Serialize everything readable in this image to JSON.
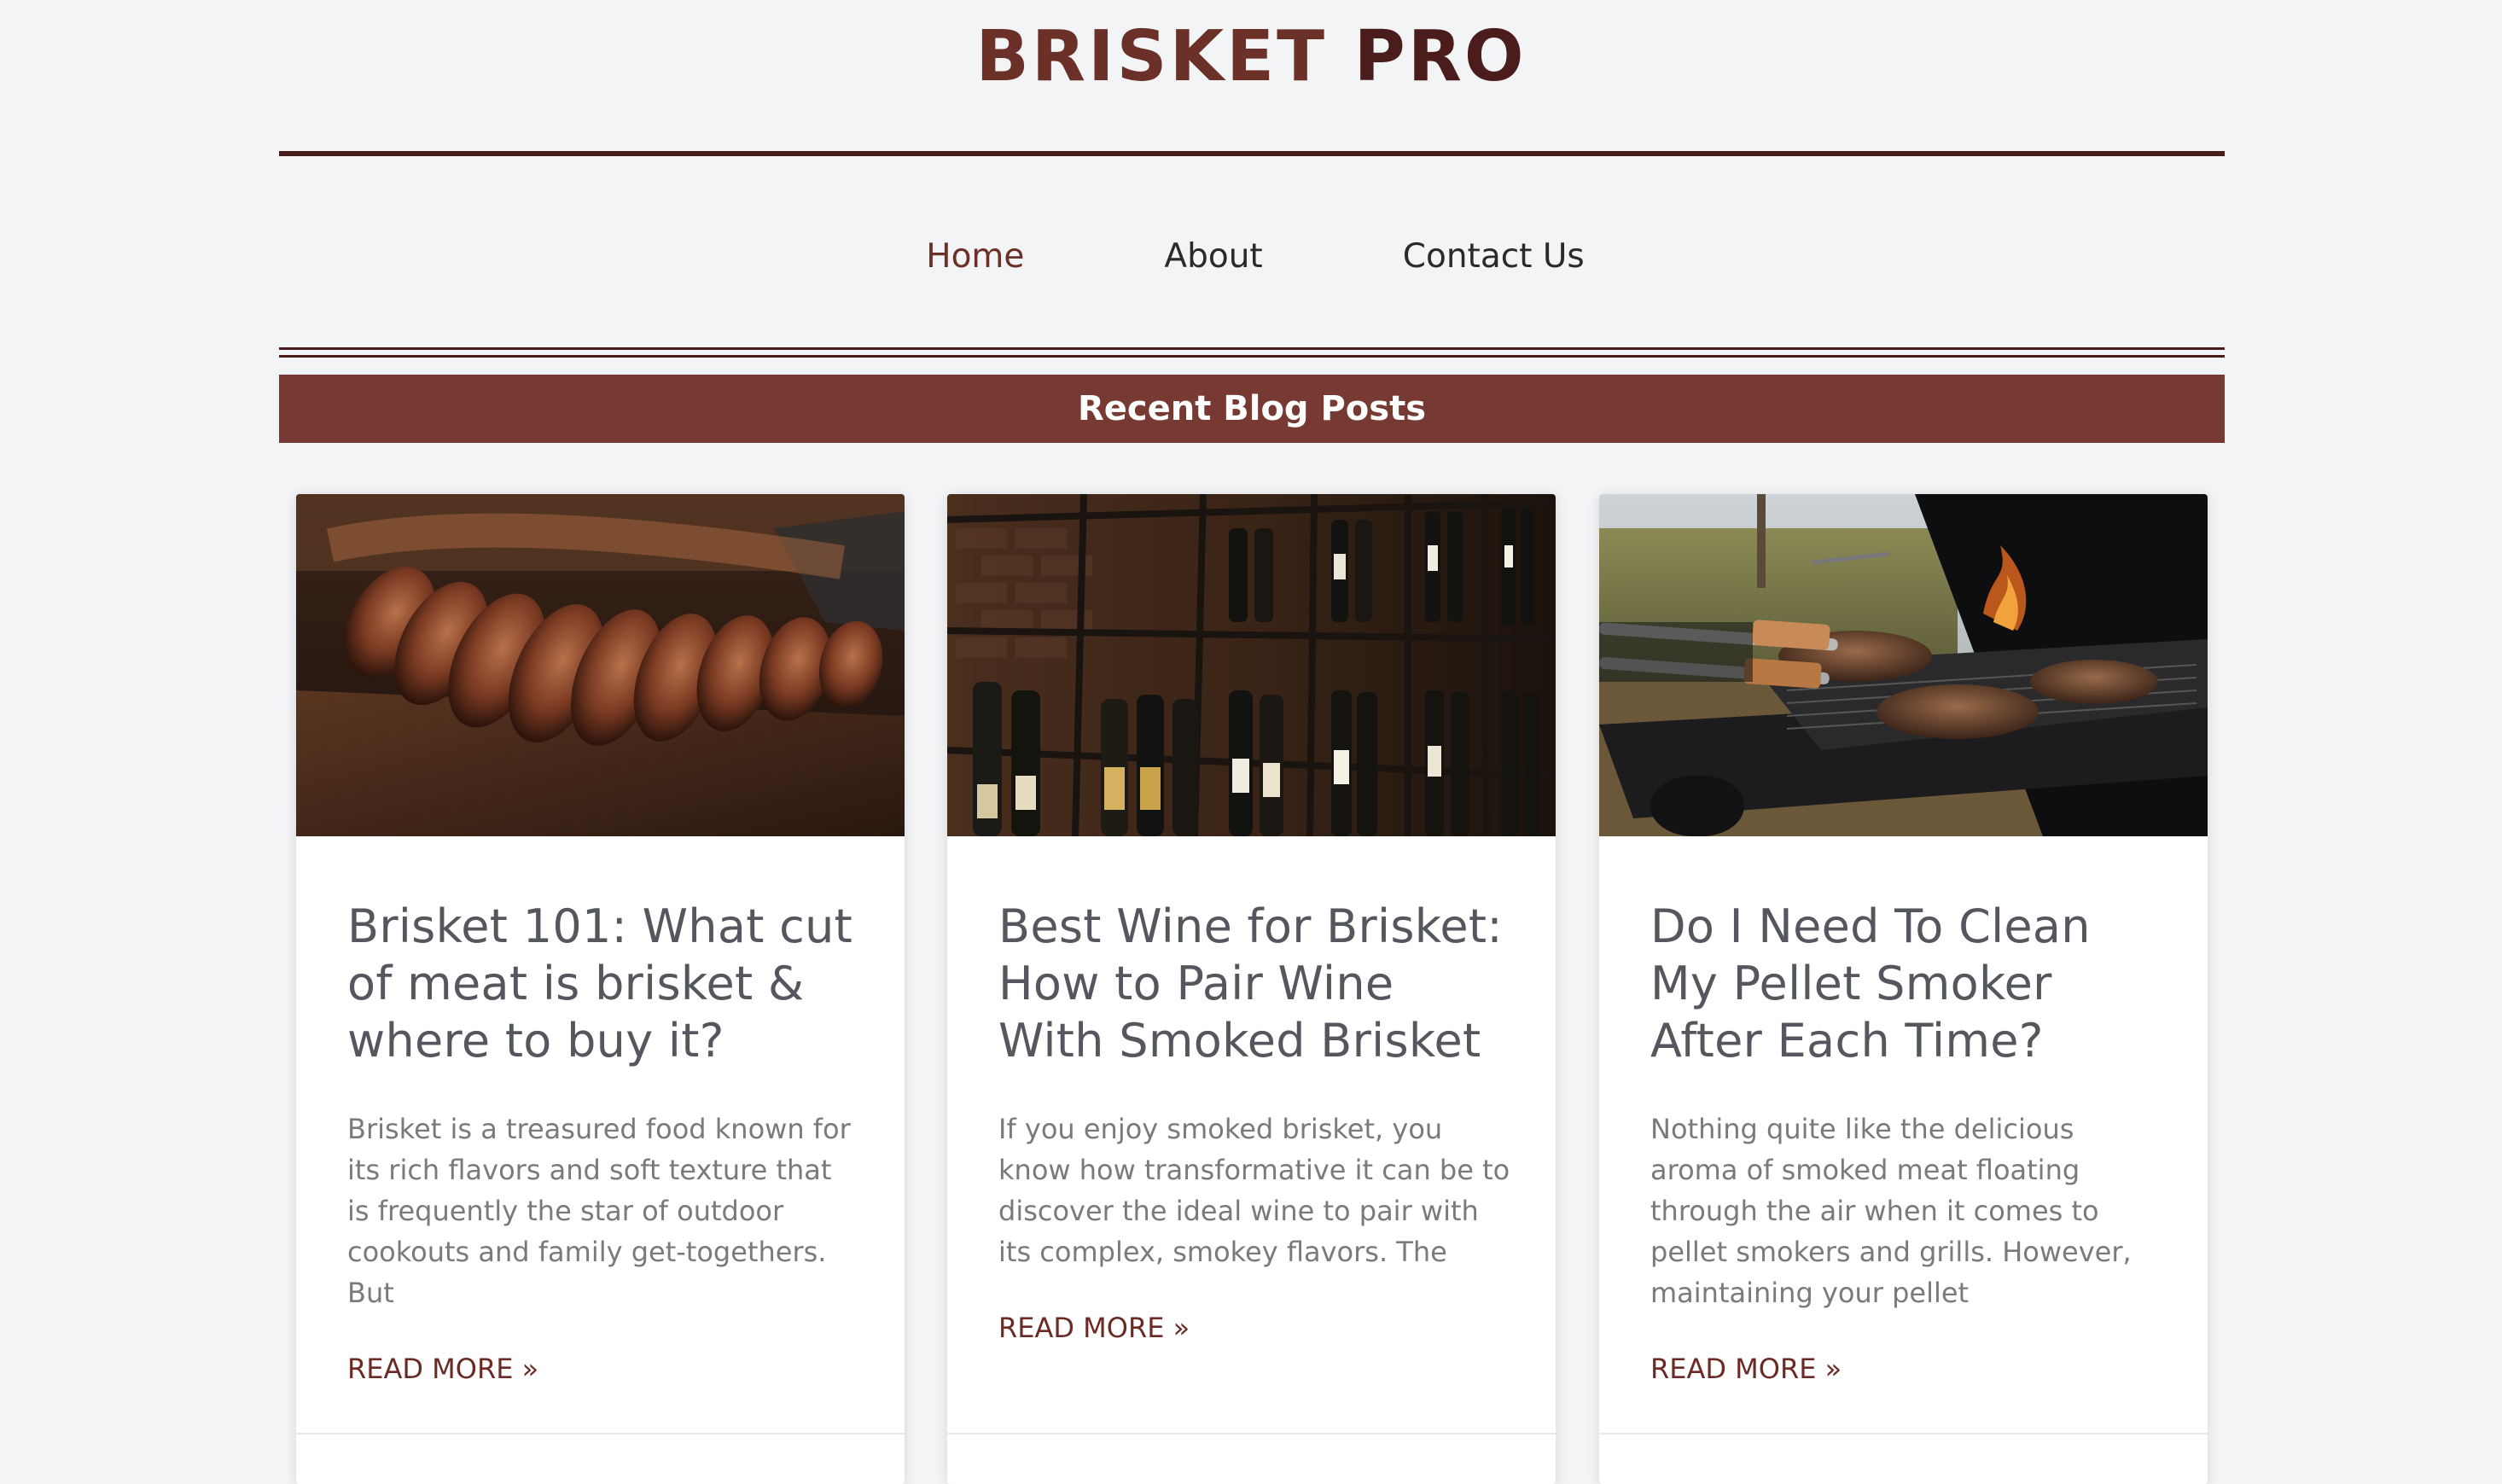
{
  "site": {
    "logo_word1": "BRISKET",
    "logo_word2": "PRO"
  },
  "nav": {
    "items": [
      "Home",
      "About",
      "Contact Us"
    ],
    "active": "Home"
  },
  "section": {
    "title": "Recent Blog Posts"
  },
  "posts": [
    {
      "image": "sliced-brisket-on-board-photo",
      "title": "Brisket 101: What cut of meat is brisket & where to buy it?",
      "excerpt": "Brisket is a treasured food known for its rich flavors and soft texture that is frequently the star of outdoor cookouts and family get-togethers. But",
      "read_more": "READ MORE »"
    },
    {
      "image": "wine-bottle-shelves-photo",
      "title": "Best Wine for Brisket: How to Pair Wine With Smoked Brisket",
      "excerpt": "If you enjoy smoked brisket, you know how transformative it can be to discover the ideal wine to pair with its complex, smokey flavors. The",
      "read_more": "READ MORE »"
    },
    {
      "image": "pellet-smoker-grill-photo",
      "title": "Do I Need To Clean My Pellet Smoker After Each Time?",
      "excerpt": "Nothing quite like the delicious aroma of smoked meat floating through the air when it comes to pellet smokers and grills. However, maintaining your pellet",
      "read_more": "READ MORE »"
    }
  ],
  "colors": {
    "brand": "#6b3028",
    "brand_dark": "#4a1c1c",
    "banner": "#773a33",
    "background": "#f3f4f6",
    "heading": "#54575d",
    "excerpt": "#7a7a7a"
  }
}
